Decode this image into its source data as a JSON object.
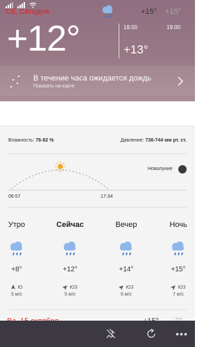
{
  "current": {
    "temp": "+12°"
  },
  "hourly": [
    {
      "time": "18:00",
      "temp": "+13°"
    },
    {
      "time": "19:00",
      "temp": ""
    }
  ],
  "hint": {
    "title": "В течение часа ожидается дождь",
    "subtitle": "Показать на карте"
  },
  "today": {
    "label": "Сб, Сегодня",
    "high": "+15°",
    "low": "+15°"
  },
  "details": {
    "humidity_label": "Влажность:",
    "humidity_value": "76-82 %",
    "pressure_label": "Давление:",
    "pressure_value": "738-744 мм рт. ст.",
    "moon_phase": "Новолуние",
    "sunrise": "06:57",
    "sunset": "17:34"
  },
  "parts": [
    {
      "name": "Утро",
      "temp": "+8°",
      "wind_dir": "Ю",
      "wind_speed": "5 м/с",
      "arrow_rot": 0
    },
    {
      "name": "Сейчас",
      "temp": "+12°",
      "wind_dir": "ЮЗ",
      "wind_speed": "5 м/с",
      "arrow_rot": 45
    },
    {
      "name": "Вечер",
      "temp": "+14°",
      "wind_dir": "ЮЗ",
      "wind_speed": "6 м/с",
      "arrow_rot": 45
    },
    {
      "name": "Ночь",
      "temp": "+15°",
      "wind_dir": "ЮЗ",
      "wind_speed": "7 м/с",
      "arrow_rot": 45
    }
  ],
  "next_day": {
    "label": "Вс, 15 октября",
    "high": "+15°",
    "low": "+7°"
  },
  "colors": {
    "accent_red": "#e02020",
    "hero": "#987885",
    "appbar": "#3c3942",
    "cloud": "#8fb7ea",
    "rain": "#3b6fc4",
    "sun": "#f5a623"
  }
}
